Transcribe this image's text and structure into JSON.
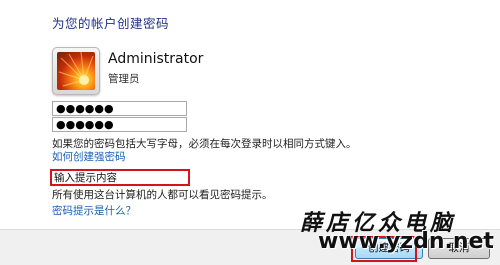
{
  "page": {
    "title": "为您的帐户创建密码"
  },
  "user": {
    "name": "Administrator",
    "role": "管理员"
  },
  "password": {
    "value": "●●●●●●",
    "confirm_value": "●●●●●●"
  },
  "help": {
    "caps_note": "如果您的密码包括大写字母，必须在每次登录时以相同方式键入。",
    "strong_link": "如何创建强密码",
    "hint_value": "输入提示内容",
    "hint_note": "所有使用这台计算机的人都可以看见密码提示。",
    "hint_link": "密码提示是什么？"
  },
  "buttons": {
    "next": "创建密码",
    "cancel": "取消"
  },
  "watermark": {
    "text_cn": "薛店亿众电脑",
    "url": "www.yzdn.net"
  },
  "colors": {
    "title": "#1e3287",
    "link": "#1a5fb4",
    "highlight": "#d4141b"
  }
}
